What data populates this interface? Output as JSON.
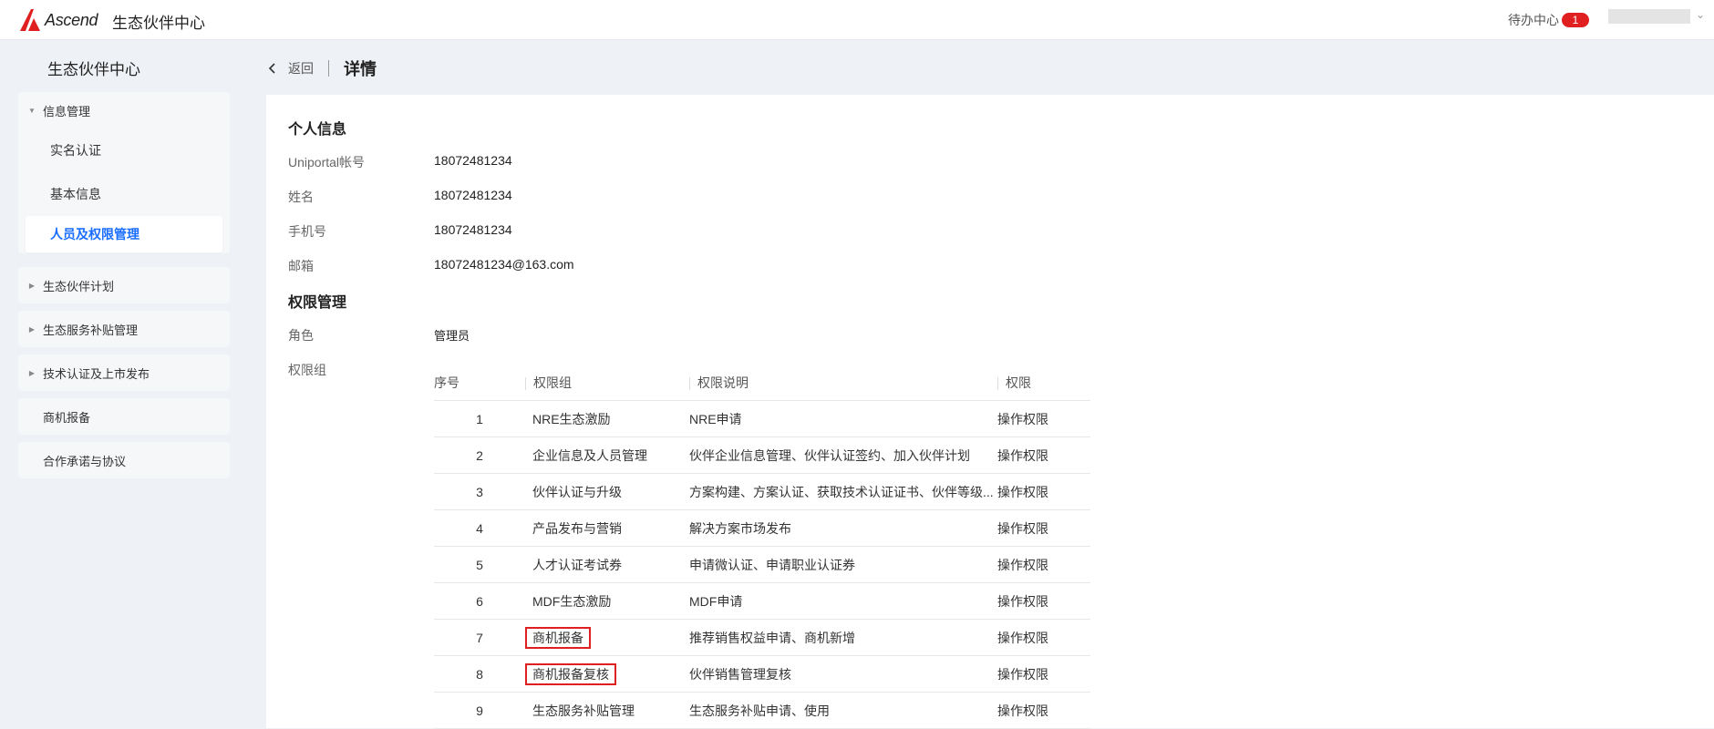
{
  "header": {
    "logo_text": "Ascend",
    "app_title": "生态伙伴中心",
    "todo_label": "待办中心",
    "todo_count": "1",
    "brand_color": "#e02020"
  },
  "sidebar": {
    "title": "生态伙伴中心",
    "groups": [
      {
        "label": "信息管理",
        "expanded": true,
        "items": [
          {
            "label": "实名认证",
            "active": false
          },
          {
            "label": "基本信息",
            "active": false
          },
          {
            "label": "人员及权限管理",
            "active": true
          }
        ]
      },
      {
        "label": "生态伙伴计划",
        "expanded": false
      },
      {
        "label": "生态服务补贴管理",
        "expanded": false
      },
      {
        "label": "技术认证及上市发布",
        "expanded": false
      },
      {
        "label": "商机报备"
      },
      {
        "label": "合作承诺与协议"
      }
    ],
    "active_color": "#1a6eff"
  },
  "breadcrumb": {
    "back_label": "返回",
    "title": "详情"
  },
  "personal": {
    "section_title": "个人信息",
    "fields": [
      {
        "label": "Uniportal帐号",
        "value": "18072481234"
      },
      {
        "label": "姓名",
        "value": "18072481234"
      },
      {
        "label": "手机号",
        "value": "18072481234"
      },
      {
        "label": "邮箱",
        "value": "18072481234@163.com"
      }
    ]
  },
  "permission": {
    "section_title": "权限管理",
    "role_label": "角色",
    "role_value": "管理员",
    "group_label": "权限组",
    "table": {
      "headers": [
        "序号",
        "权限组",
        "权限说明",
        "权限"
      ],
      "rows": [
        {
          "idx": "1",
          "group": "NRE生态激励",
          "desc": "NRE申请",
          "perm": "操作权限",
          "highlight": false
        },
        {
          "idx": "2",
          "group": "企业信息及人员管理",
          "desc": "伙伴企业信息管理、伙伴认证签约、加入伙伴计划",
          "perm": "操作权限",
          "highlight": false
        },
        {
          "idx": "3",
          "group": "伙伴认证与升级",
          "desc": "方案构建、方案认证、获取技术认证证书、伙伴等级...",
          "perm": "操作权限",
          "highlight": false
        },
        {
          "idx": "4",
          "group": "产品发布与营销",
          "desc": "解决方案市场发布",
          "perm": "操作权限",
          "highlight": false
        },
        {
          "idx": "5",
          "group": "人才认证考试券",
          "desc": "申请微认证、申请职业认证券",
          "perm": "操作权限",
          "highlight": false
        },
        {
          "idx": "6",
          "group": "MDF生态激励",
          "desc": "MDF申请",
          "perm": "操作权限",
          "highlight": false
        },
        {
          "idx": "7",
          "group": "商机报备",
          "desc": "推荐销售权益申请、商机新增",
          "perm": "操作权限",
          "highlight": true
        },
        {
          "idx": "8",
          "group": "商机报备复核",
          "desc": "伙伴销售管理复核",
          "perm": "操作权限",
          "highlight": true
        },
        {
          "idx": "9",
          "group": "生态服务补贴管理",
          "desc": "生态服务补贴申请、使用",
          "perm": "操作权限",
          "highlight": false
        }
      ]
    }
  }
}
